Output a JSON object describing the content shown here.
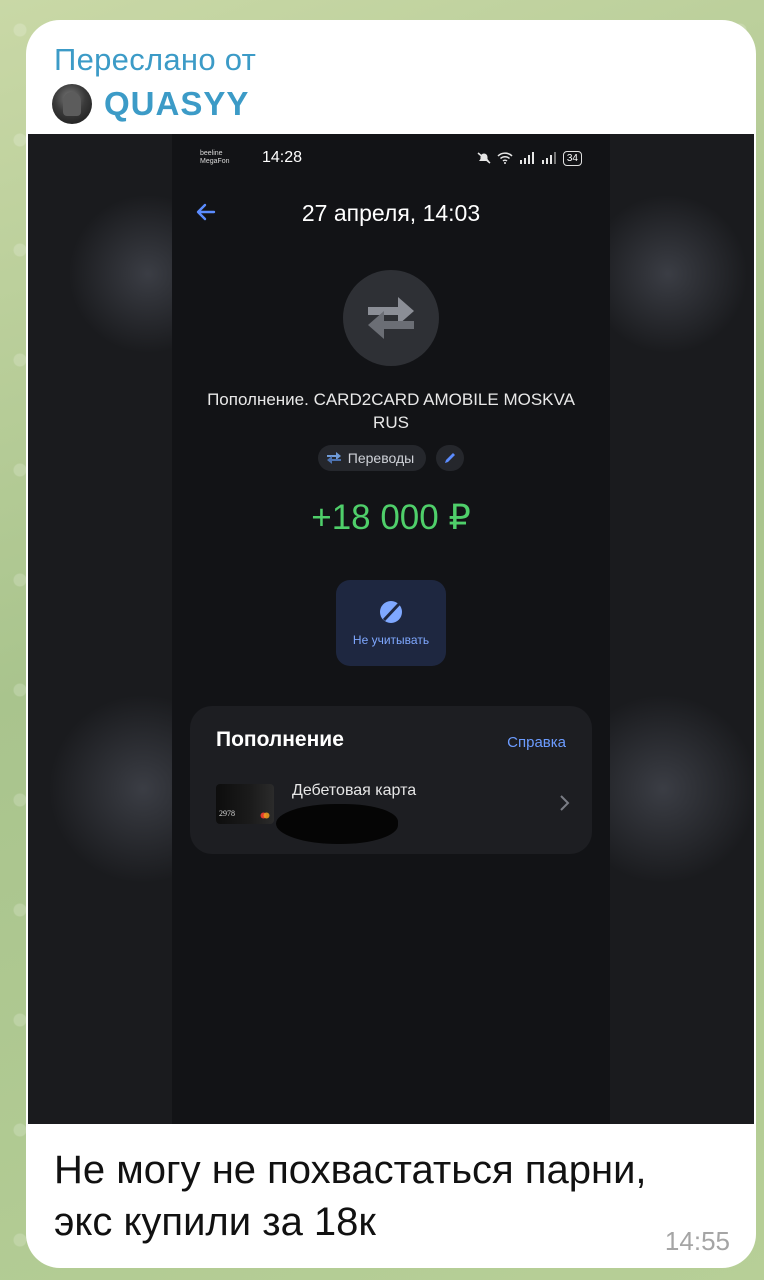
{
  "message": {
    "forwarded_label": "Переслано от",
    "forwarded_author": "QUASYY",
    "caption_line1": "Не могу не похвастаться парни,",
    "caption_line2": "экс купили за 18к",
    "time": "14:55"
  },
  "screenshot": {
    "status_bar": {
      "carrier1": "beeline",
      "carrier2": "MegaFon",
      "time": "14:28",
      "battery": "34"
    },
    "header_title": "27 апреля, 14:03",
    "transaction_title": "Пополнение. CARD2CARD AMOBILE MOSKVA RUS",
    "category_chip": "Переводы",
    "amount": "+18 000 ₽",
    "ignore_label": "Не учитывать",
    "panel": {
      "title": "Пополнение",
      "help_link": "Справка",
      "card_type": "Дебетовая карта",
      "card_last_digits": "2978"
    }
  },
  "colors": {
    "accent_link": "#3c9bc7",
    "amount_green": "#4fcf6a",
    "help_blue": "#6c9cff"
  }
}
